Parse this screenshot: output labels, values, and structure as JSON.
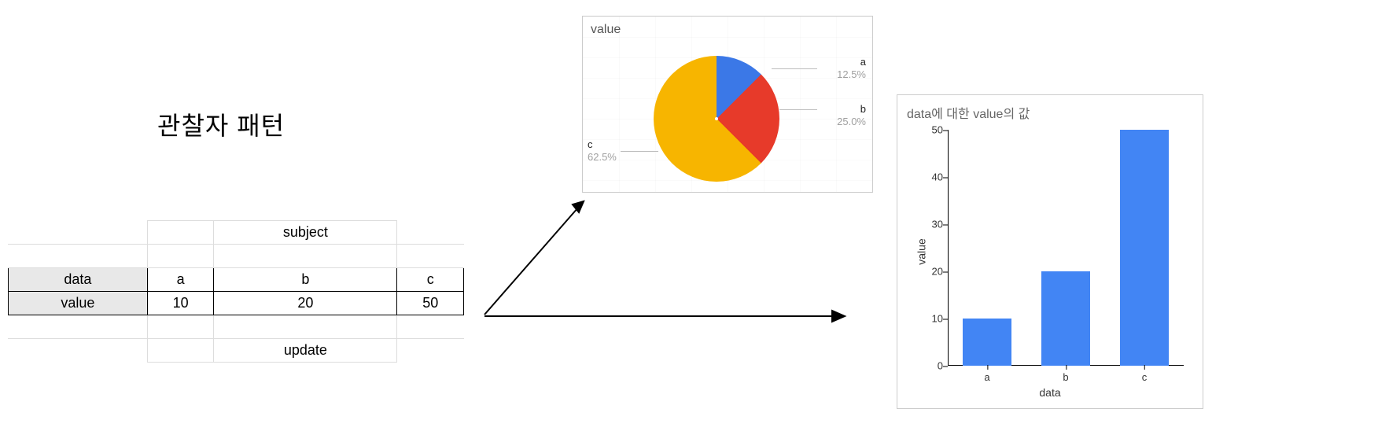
{
  "title": "관찰자 패턴",
  "sheet": {
    "subject_label": "subject",
    "update_label": "update",
    "rows": [
      {
        "header": "data",
        "cols": [
          "a",
          "b",
          "c"
        ]
      },
      {
        "header": "value",
        "cols": [
          "10",
          "20",
          "50"
        ]
      }
    ]
  },
  "pie": {
    "title": "value",
    "slices": [
      {
        "name": "a",
        "pct": "12.5%",
        "value": 12.5,
        "color": "#3b78e7"
      },
      {
        "name": "b",
        "pct": "25.0%",
        "value": 25.0,
        "color": "#e73a2a"
      },
      {
        "name": "c",
        "pct": "62.5%",
        "value": 62.5,
        "color": "#f7b500"
      }
    ]
  },
  "bar": {
    "title": "data에 대한 value의 값",
    "xlabel": "data",
    "ylabel": "value",
    "ylim": [
      0,
      50
    ],
    "yticks": [
      "0",
      "10",
      "20",
      "30",
      "40",
      "50"
    ],
    "categories": [
      "a",
      "b",
      "c"
    ],
    "values": [
      10,
      20,
      50
    ]
  },
  "chart_data": [
    {
      "type": "pie",
      "title": "value",
      "categories": [
        "a",
        "b",
        "c"
      ],
      "values": [
        12.5,
        25.0,
        62.5
      ]
    },
    {
      "type": "bar",
      "title": "data에 대한 value의 값",
      "xlabel": "data",
      "ylabel": "value",
      "ylim": [
        0,
        50
      ],
      "categories": [
        "a",
        "b",
        "c"
      ],
      "values": [
        10,
        20,
        50
      ]
    }
  ]
}
